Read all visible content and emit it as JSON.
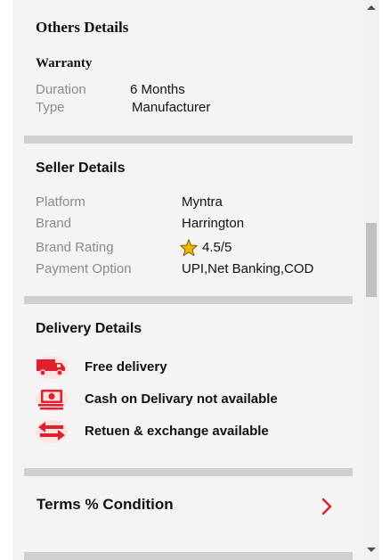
{
  "others": {
    "title": "Others Details",
    "warranty_heading": "Warranty",
    "rows": [
      {
        "label": "Duration",
        "value": "6 Months"
      },
      {
        "label": "Type",
        "value": "Manufacturer"
      }
    ]
  },
  "seller": {
    "title": "Seller Details",
    "rows": [
      {
        "label": "Platform",
        "value": "Myntra"
      },
      {
        "label": "Brand",
        "value": "Harrington"
      },
      {
        "label": "Brand Rating",
        "value": "4.5/5"
      },
      {
        "label": "Payment Option",
        "value": "UPI,Net Banking,COD"
      }
    ],
    "rating_icon": "star-icon"
  },
  "delivery": {
    "title": "Delivery Details",
    "items": [
      {
        "icon": "truck-icon",
        "label": "Free delivery"
      },
      {
        "icon": "cash-icon",
        "label": "Cash on Delivary not available"
      },
      {
        "icon": "exchange-icon",
        "label": "Retuen & exchange available"
      }
    ]
  },
  "terms": {
    "label": "Terms % Condition",
    "icon": "chevron-right-icon"
  },
  "colors": {
    "accent": "#e0202a",
    "star": "#f5b301",
    "divider": "#d0d0d0",
    "panel_bg": "#f4f4f4"
  }
}
